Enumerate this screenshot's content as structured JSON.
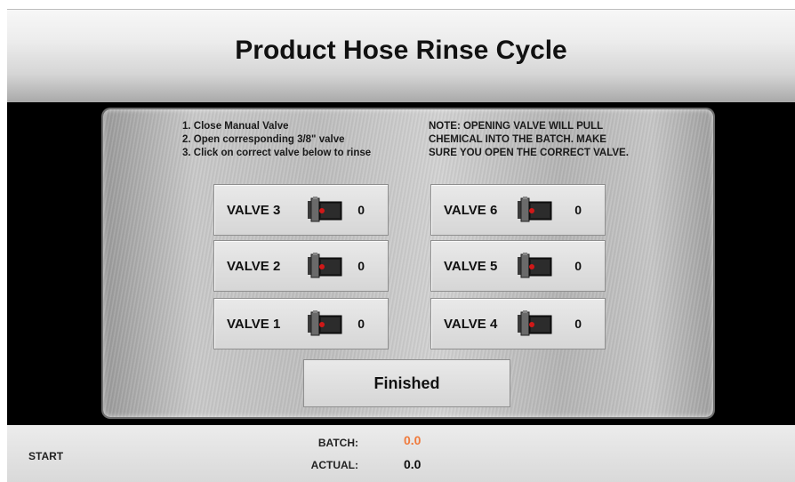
{
  "header": {
    "title": "Product Hose Rinse Cycle"
  },
  "instructions": {
    "steps": [
      "1. Close Manual Valve",
      "2. Open corresponding 3/8\" valve",
      "3. Click on correct valve below to rinse"
    ],
    "note": [
      "NOTE:  OPENING VALVE WILL PULL",
      "CHEMICAL INTO THE BATCH. MAKE",
      "SURE YOU OPEN THE CORRECT VALVE."
    ]
  },
  "valves": [
    {
      "label": "VALVE 3",
      "count": "0"
    },
    {
      "label": "VALVE 6",
      "count": "0"
    },
    {
      "label": "VALVE 2",
      "count": "0"
    },
    {
      "label": "VALVE 5",
      "count": "0"
    },
    {
      "label": "VALVE 1",
      "count": "0"
    },
    {
      "label": "VALVE 4",
      "count": "0"
    }
  ],
  "finished_label": "Finished",
  "footer": {
    "start_label": "START",
    "batch_label": "BATCH:",
    "batch_value": "0.0",
    "actual_label": "ACTUAL:",
    "actual_value": "0.0"
  },
  "colors": {
    "batch_value": "#f07a3c",
    "valve_indicator": "#d01818",
    "background_main": "#000000"
  },
  "icons": {
    "valve": "valve-actuator-icon"
  }
}
